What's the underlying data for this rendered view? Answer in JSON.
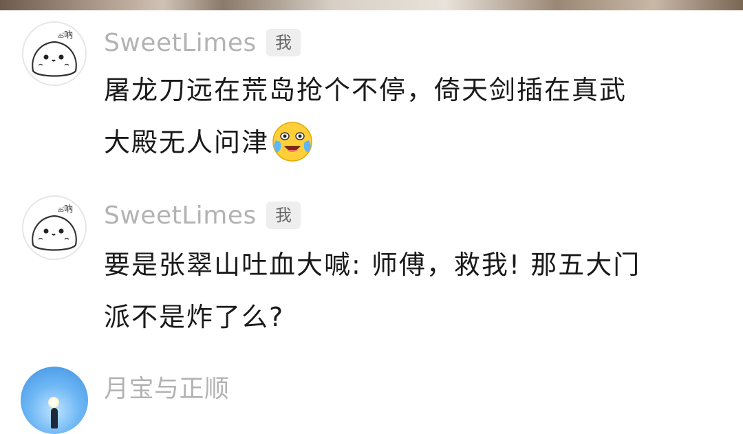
{
  "comments": [
    {
      "username": "SweetLimes",
      "badge": "我",
      "line1": "屠龙刀远在荒岛抢个不停，倚天剑插在真武",
      "line2": "大殿无人问津",
      "emoji": "crying-laughing-emoji"
    },
    {
      "username": "SweetLimes",
      "badge": "我",
      "line1": "要是张翠山吐血大喊: 师傅，救我! 那五大门",
      "line2": "派不是炸了么?"
    },
    {
      "username": "月宝与正顺"
    }
  ],
  "colors": {
    "username": "#b3b3b3",
    "text": "#1a1a1a",
    "badge_bg": "#eeeeee"
  }
}
